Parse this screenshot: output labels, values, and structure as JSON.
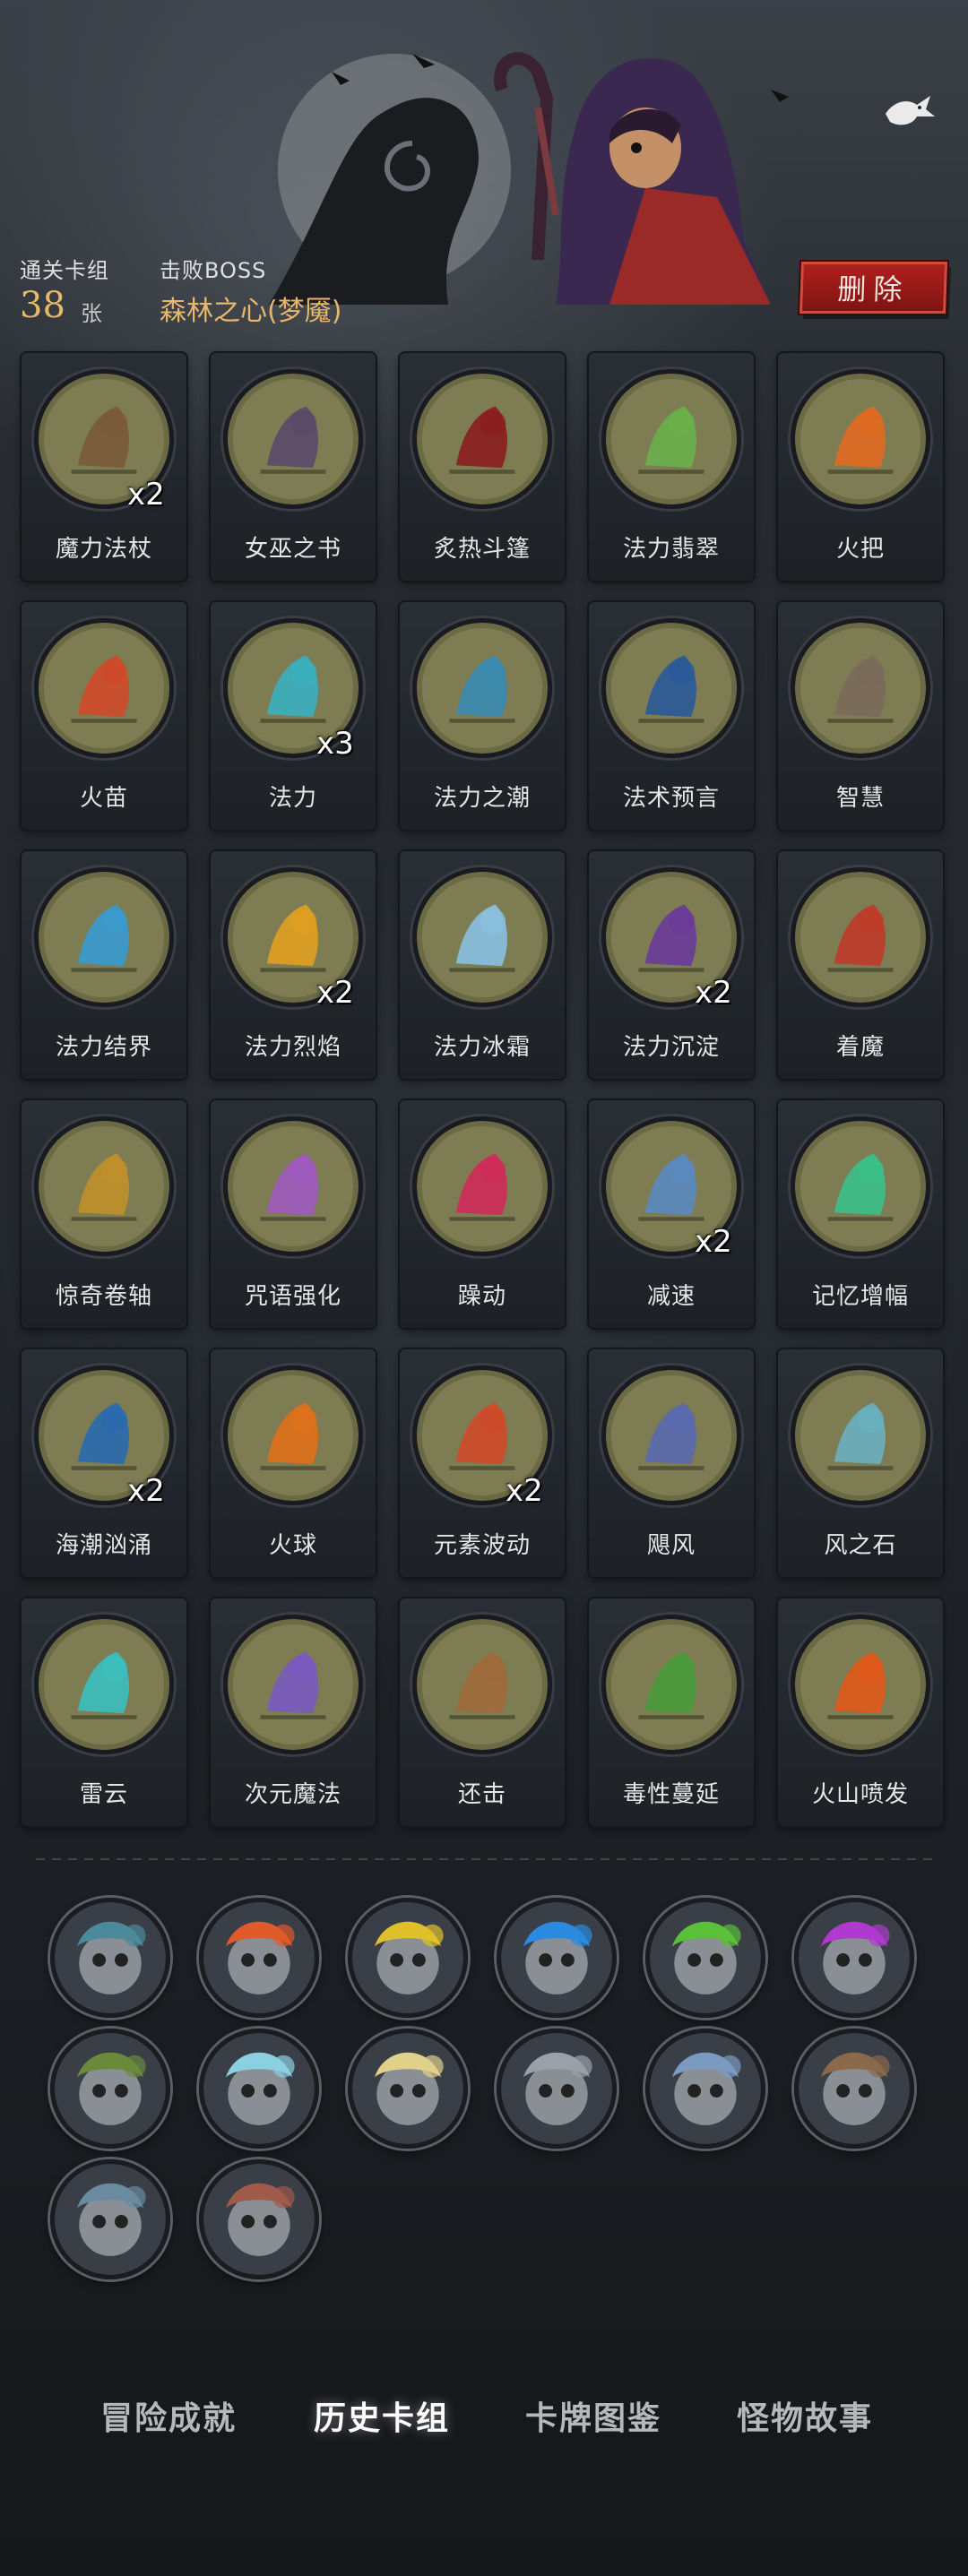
{
  "header": {
    "cleared_deck_label": "通关卡组",
    "card_count": "38",
    "card_unit": "张",
    "defeated_boss_label": "击败BOSS",
    "boss_name": "森林之心(梦魇)",
    "delete_label": "删除"
  },
  "cards": [
    {
      "name": "魔力法杖",
      "mult": "x2",
      "icon": "wizard-staff-icon",
      "color": "#7a5a3a"
    },
    {
      "name": "女巫之书",
      "mult": "",
      "icon": "witch-book-icon",
      "color": "#5a4a6a"
    },
    {
      "name": "炙热斗篷",
      "mult": "",
      "icon": "red-cloak-icon",
      "color": "#8a1e1e"
    },
    {
      "name": "法力翡翠",
      "mult": "",
      "icon": "mana-emerald-icon",
      "color": "#6ab04a"
    },
    {
      "name": "火把",
      "mult": "",
      "icon": "torch-icon",
      "color": "#e06a20"
    },
    {
      "name": "火苗",
      "mult": "",
      "icon": "flame-hand-icon",
      "color": "#d04a2a"
    },
    {
      "name": "法力",
      "mult": "x3",
      "icon": "mana-orb-icon",
      "color": "#3ab0c0"
    },
    {
      "name": "法力之潮",
      "mult": "",
      "icon": "mana-tide-icon",
      "color": "#3a8ab0"
    },
    {
      "name": "法术预言",
      "mult": "",
      "icon": "spell-prophecy-icon",
      "color": "#2a5a9a"
    },
    {
      "name": "智慧",
      "mult": "",
      "icon": "sage-icon",
      "color": "#7a6a5a"
    },
    {
      "name": "法力结界",
      "mult": "",
      "icon": "mana-barrier-icon",
      "color": "#3a9ad0"
    },
    {
      "name": "法力烈焰",
      "mult": "x2",
      "icon": "mana-blaze-icon",
      "color": "#e0a020"
    },
    {
      "name": "法力冰霜",
      "mult": "",
      "icon": "mana-frost-icon",
      "color": "#8ac0e0"
    },
    {
      "name": "法力沉淀",
      "mult": "x2",
      "icon": "mana-sediment-icon",
      "color": "#6a3a9a"
    },
    {
      "name": "着魔",
      "mult": "",
      "icon": "possessed-icon",
      "color": "#c03a2a"
    },
    {
      "name": "惊奇卷轴",
      "mult": "",
      "icon": "scroll-icon",
      "color": "#c0902a"
    },
    {
      "name": "咒语强化",
      "mult": "",
      "icon": "spell-boost-icon",
      "color": "#a05ac0"
    },
    {
      "name": "躁动",
      "mult": "",
      "icon": "frenzy-icon",
      "color": "#d02a5a"
    },
    {
      "name": "减速",
      "mult": "x2",
      "icon": "slow-clock-icon",
      "color": "#5a8ac0"
    },
    {
      "name": "记忆增幅",
      "mult": "",
      "icon": "memory-boost-icon",
      "color": "#3ac08a"
    },
    {
      "name": "海潮汹涌",
      "mult": "x2",
      "icon": "tidal-wave-icon",
      "color": "#2a6ab0"
    },
    {
      "name": "火球",
      "mult": "",
      "icon": "fireball-icon",
      "color": "#e0701a"
    },
    {
      "name": "元素波动",
      "mult": "x2",
      "icon": "element-wave-icon",
      "color": "#d04a2a"
    },
    {
      "name": "飓风",
      "mult": "",
      "icon": "hurricane-icon",
      "color": "#5a6ab0"
    },
    {
      "name": "风之石",
      "mult": "",
      "icon": "wind-stone-icon",
      "color": "#6ab0c0"
    },
    {
      "name": "雷云",
      "mult": "",
      "icon": "thundercloud-icon",
      "color": "#3ac0c0"
    },
    {
      "name": "次元魔法",
      "mult": "",
      "icon": "dimension-magic-icon",
      "color": "#7a5ac0"
    },
    {
      "name": "还击",
      "mult": "",
      "icon": "counterattack-icon",
      "color": "#a06a3a"
    },
    {
      "name": "毒性蔓延",
      "mult": "",
      "icon": "poison-spread-icon",
      "color": "#4a9a3a"
    },
    {
      "name": "火山喷发",
      "mult": "",
      "icon": "volcano-icon",
      "color": "#e05a1a"
    }
  ],
  "relics": [
    {
      "icon": "spellbook-relic-icon",
      "color": "#4a8a9a"
    },
    {
      "icon": "fire-skull-relic-icon",
      "color": "#e05a2a"
    },
    {
      "icon": "gold-skull-relic-icon",
      "color": "#e0c02a"
    },
    {
      "icon": "blue-skull-relic-icon",
      "color": "#2a8ae0"
    },
    {
      "icon": "green-skull-relic-icon",
      "color": "#5ac03a"
    },
    {
      "icon": "purple-skull-relic-icon",
      "color": "#b03ad0"
    },
    {
      "icon": "goblin-relic-icon",
      "color": "#6a8a3a"
    },
    {
      "icon": "ice-swords-relic-icon",
      "color": "#8ad0e0"
    },
    {
      "icon": "shining-book-relic-icon",
      "color": "#e0d08a"
    },
    {
      "icon": "ghost-cards-relic-icon",
      "color": "#9aa0a8"
    },
    {
      "icon": "clock-relic-icon",
      "color": "#7a9ac0"
    },
    {
      "icon": "pirate-relic-icon",
      "color": "#8a6a4a"
    },
    {
      "icon": "dagger-relic-icon",
      "color": "#6a8aa0"
    },
    {
      "icon": "brute-relic-icon",
      "color": "#a05a4a"
    }
  ],
  "nav": {
    "tabs": [
      "冒险成就",
      "历史卡组",
      "卡牌图鉴",
      "怪物故事"
    ],
    "active_index": 1
  }
}
